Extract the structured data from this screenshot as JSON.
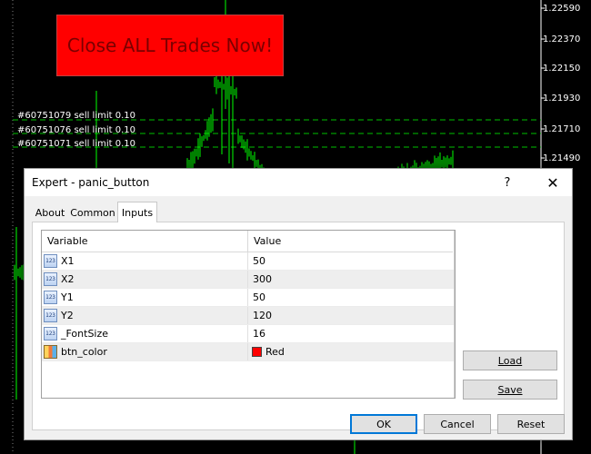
{
  "chart": {
    "price_labels": [
      "1.22590",
      "1.22370",
      "1.22150",
      "1.21930",
      "1.21710",
      "1.21490"
    ],
    "order_lines": [
      "#60751079 sell limit 0.10",
      "#60751076 sell limit 0.10",
      "#60751071 sell limit 0.10"
    ],
    "candle_color": "#00ff00",
    "order_line_color": "#00c000"
  },
  "panic_button": {
    "label": "Close ALL Trades Now!",
    "color": "#ff0000"
  },
  "dialog": {
    "title": "Expert - panic_button",
    "help_label": "?",
    "close_label": "✕",
    "tabs": [
      {
        "label": "About",
        "active": false
      },
      {
        "label": "Common",
        "active": false
      },
      {
        "label": "Inputs",
        "active": true
      }
    ],
    "table": {
      "headers": {
        "variable": "Variable",
        "value": "Value"
      },
      "rows": [
        {
          "icon": "int-icon",
          "icon_text": "123",
          "name": "X1",
          "value": "50"
        },
        {
          "icon": "int-icon",
          "icon_text": "123",
          "name": "X2",
          "value": "300"
        },
        {
          "icon": "int-icon",
          "icon_text": "123",
          "name": "Y1",
          "value": "50"
        },
        {
          "icon": "int-icon",
          "icon_text": "123",
          "name": "Y2",
          "value": "120"
        },
        {
          "icon": "int-icon",
          "icon_text": "123",
          "name": "_FontSize",
          "value": "16"
        },
        {
          "icon": "color-icon",
          "icon_text": "",
          "name": "btn_color",
          "value": "Red",
          "swatch": "#ff0000"
        }
      ]
    },
    "buttons": {
      "load": "Load",
      "save": "Save",
      "ok": "OK",
      "cancel": "Cancel",
      "reset": "Reset"
    }
  }
}
